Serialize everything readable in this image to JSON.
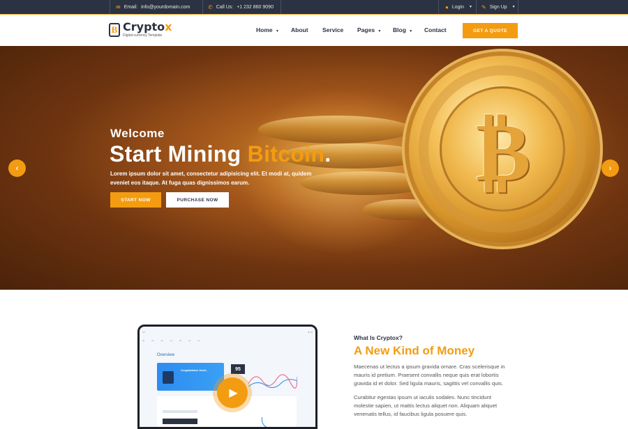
{
  "topbar": {
    "email_label": "Email:",
    "email_value": "info@yourdomain.com",
    "call_label": "Call Us:",
    "call_value": "+1 232 860 9090",
    "login": "Login",
    "signup": "Sign Up"
  },
  "brand": {
    "name_main": "Crypto",
    "name_accent": "x",
    "tagline": "Digital-currency Template"
  },
  "nav": {
    "items": [
      "Home",
      "About",
      "Service",
      "Pages",
      "Blog",
      "Contact"
    ],
    "cta": "GET A QUOTE"
  },
  "hero": {
    "welcome": "Welcome",
    "title_main": "Start Mining ",
    "title_accent": "Bitcoin",
    "title_end": ".",
    "description": "Lorem ipsum dolor sit amet, consectetur adipisicing elit. Et modi at, quidem eveniet eos itaque. At fuga quas dignissimos earum.",
    "btn_start": "START NOW",
    "btn_purchase": "PURCHASE NOW",
    "prev": "‹",
    "next": "›"
  },
  "about": {
    "kicker": "What Is Cryptox?",
    "title": "A New Kind of Money",
    "p1": "Maecenas ut lectus a ipsum gravida ornare. Cras scelerisque in mauris id pretium. Praesent convallis neque quis erat lobortis gravida id et dolor. Sed ligula mauris, sagittis vel convallis quis.",
    "p2": "Curabitur egestas ipsum ut iaculis sodales. Nunc tincidunt molestie sapien, ut mattis lectus aliquet non. Aliquam aliquet venenatis tellus, id faucibus ligula posuere quis."
  },
  "dashboard": {
    "overview": "Overview",
    "congrats": "Congratulation Jessie,",
    "score": "95"
  },
  "colors": {
    "accent": "#f39c12",
    "dark": "#2b3242"
  }
}
